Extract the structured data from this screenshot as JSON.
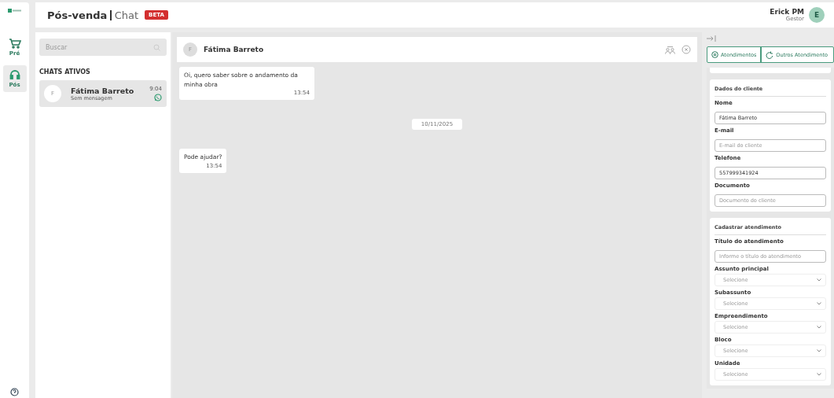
{
  "header": {
    "title": "Pós-venda",
    "subtitle": "Chat",
    "badge": "BETA",
    "user": {
      "name": "Erick PM",
      "role": "Gestor",
      "initial": "E"
    }
  },
  "nav": [
    {
      "label": "Pré",
      "kind": "cart",
      "selected": false
    },
    {
      "label": "Pós",
      "kind": "headset",
      "selected": true
    }
  ],
  "chat_list": {
    "search_placeholder": "Buscar",
    "section": "CHATS ATIVOS",
    "items": [
      {
        "initial": "F",
        "name": "Fátima Barreto",
        "preview": "Sem mensagem",
        "time": "9:04",
        "selected": true
      }
    ]
  },
  "conversation": {
    "initial": "F",
    "name": "Fátima Barreto",
    "messages": [
      {
        "kind": "message",
        "text": "Oi, quero saber sobre o andamento da minha obra",
        "time": "13:54"
      },
      {
        "kind": "date",
        "text": "10/11/2025"
      },
      {
        "kind": "message",
        "text": "Pode ajudar?",
        "time": "13:54"
      }
    ]
  },
  "side_panel": {
    "tabs": [
      {
        "label": "Atendimentos"
      },
      {
        "label": "Outros Atendimento"
      }
    ],
    "client": {
      "title": "Dados do cliente",
      "fields": [
        {
          "label": "Nome",
          "value": "Fátima Barreto"
        },
        {
          "label": "E-mail",
          "placeholder": "E-mail do cliente"
        },
        {
          "label": "Telefone",
          "value": "557999341924"
        },
        {
          "label": "Documento",
          "placeholder": "Documento do cliente"
        }
      ]
    },
    "ticket": {
      "title": "Cadastrar atendimento",
      "fields": [
        {
          "kind": "input",
          "label": "Título do atendimento",
          "placeholder": "Informe o título do atendimento"
        },
        {
          "kind": "select",
          "label": "Assunto principal",
          "placeholder": "Selecione"
        },
        {
          "kind": "select",
          "label": "Subassunto",
          "placeholder": "Selecione"
        },
        {
          "kind": "select",
          "label": "Empreendimento",
          "placeholder": "Selecione"
        },
        {
          "kind": "select",
          "label": "Bloco",
          "placeholder": "Selecione"
        },
        {
          "kind": "select",
          "label": "Unidade",
          "placeholder": "Selecione"
        }
      ]
    }
  }
}
